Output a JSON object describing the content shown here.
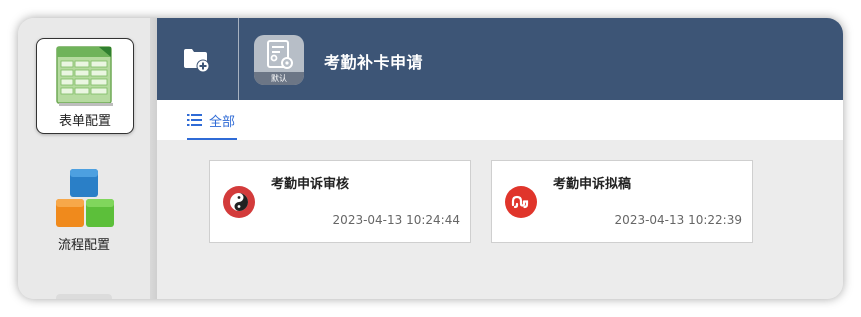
{
  "sidebar": {
    "items": [
      {
        "label": "表单配置",
        "icon": "spreadsheet-icon",
        "active": true
      },
      {
        "label": "流程配置",
        "icon": "blocks-icon",
        "active": false
      }
    ]
  },
  "header": {
    "new_folder_icon": "folder-plus-icon",
    "form_icon": "form-settings-icon",
    "form_badge": "默认",
    "title": "考勤补卡申请"
  },
  "tabs": [
    {
      "label": "全部",
      "icon": "list-icon",
      "active": true
    }
  ],
  "cards": [
    {
      "title": "考勤申诉审核",
      "time": "2023-04-13 10:24:44",
      "icon": "yin-yang-icon",
      "icon_color": "#d33b3b"
    },
    {
      "title": "考勤申诉拟稿",
      "time": "2023-04-13 10:22:39",
      "icon": "stumbleupon-icon",
      "icon_color": "#e0352b"
    }
  ],
  "colors": {
    "header_bg": "#3d5576",
    "accent": "#2f6bd6"
  }
}
